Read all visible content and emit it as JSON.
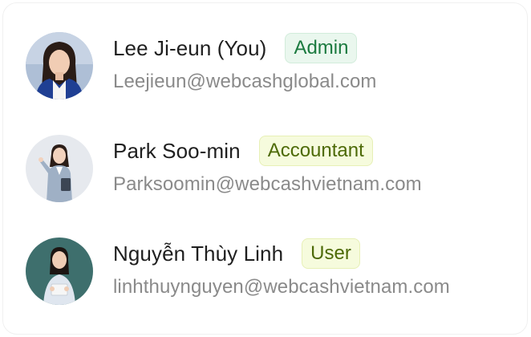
{
  "members": [
    {
      "name": "Lee Ji-eun (You)",
      "role": "Admin",
      "email": "Leejieun@webcashglobal.com",
      "avatar": "user-photo-avatar"
    },
    {
      "name": "Park Soo-min",
      "role": "Accountant",
      "email": "Parksoomin@webcashvietnam.com",
      "avatar": "user-photo-avatar"
    },
    {
      "name": "Nguyễn Thùy Linh",
      "role": "User",
      "email": "linhthuynguyen@webcashvietnam.com",
      "avatar": "user-photo-avatar"
    }
  ],
  "colors": {
    "admin_badge_bg": "#eaf7ee",
    "admin_badge_text": "#1b7a3f",
    "role_badge_bg": "#f6fbdd",
    "role_badge_text": "#4d6a07",
    "name_text": "#1f1f1f",
    "email_text": "#8a8a8a"
  }
}
